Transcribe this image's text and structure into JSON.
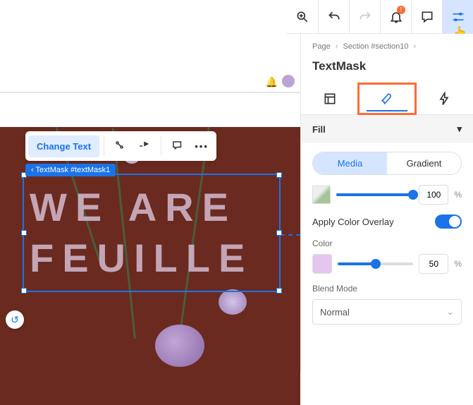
{
  "topbar": {
    "notification_count": "!"
  },
  "canvas": {
    "change_text_label": "Change Text",
    "element_tag": "TextMask #textMask1",
    "mask_line1": "WE ARE",
    "mask_line2": "FEUILLE"
  },
  "panel": {
    "crumbs": {
      "page": "Page",
      "section": "Section #section10"
    },
    "title": "TextMask",
    "fill_header": "Fill",
    "fill": {
      "media_label": "Media",
      "gradient_label": "Gradient",
      "opacity_value": "100",
      "overlay_label": "Apply Color Overlay",
      "color_label": "Color",
      "color_hex": "#e4c6f0",
      "color_opacity": "50",
      "blend_label": "Blend Mode",
      "blend_value": "Normal"
    }
  }
}
